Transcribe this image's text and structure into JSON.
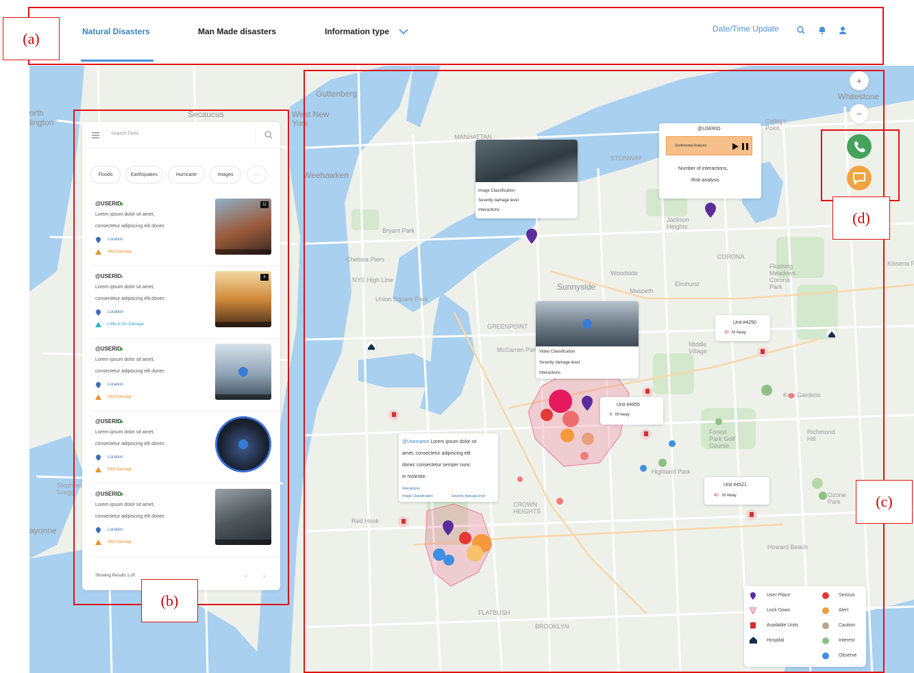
{
  "nav": {
    "tabs": [
      {
        "label": "Natural Disasters",
        "active": true
      },
      {
        "label": "Man Made disasters",
        "active": false
      },
      {
        "label": "Information type",
        "active": false
      }
    ],
    "datetime_label": "Date/Time Update",
    "icons": [
      "search-icon",
      "bell-icon",
      "user-icon",
      "chevron-down-icon"
    ]
  },
  "map": {
    "places": {
      "guttenberg": "Guttenberg",
      "secaucus": "Secaucus",
      "west_new_york": "West New York",
      "weehawken": "Weehawken",
      "manhattan": "MANHATTAN",
      "whitestone": "Whitestone",
      "college_point": "College Point",
      "jackson_heights": "Jackson Heights",
      "sunnyside": "Sunnyside",
      "woodside": "Woodside",
      "maspeth": "Maspeth",
      "elmhurst": "Elmhurst",
      "middle_village": "Middle Village",
      "kew_gardens": "Kew Gardens",
      "richmond_hill": "Richmond Hill",
      "ozone_park": "Ozone Park",
      "howard_beach": "Howard Beach",
      "brooklyn": "BROOKLYN",
      "bayonne": "ayonne",
      "steinway": "STEINWAY",
      "greenpoint": "GREENPOINT",
      "red_hook": "Red Hook",
      "crown_heights": "CROWN HEIGHTS",
      "flatbush": "FLATBUSH",
      "corona": "CORONA",
      "flushing": "Flushing Meadows Corona Park",
      "kissena": "Kissena P",
      "stephens_greg": "Stephens Gregg",
      "orth": "orth",
      "lington": "lington",
      "union_square": "Union Square Park",
      "nyc_high_line": "NYC High Line",
      "chelsea_piers": "Chelsea Piers",
      "bryant_park": "Bryant Park",
      "mccarren_park": "McCarren Park",
      "highland_park": "Highland Park",
      "forest_park": "Forest Park Golf Course"
    }
  },
  "feed": {
    "search_placeholder": "Search Feed",
    "chips": [
      "Floods",
      "Earthquakes",
      "Hurricane",
      "Images",
      "···"
    ],
    "posts": [
      {
        "user": "@USERID",
        "line1": "Lorem ipsum dolor sit amet,",
        "line2": "consectetur adipiscing elit donec",
        "location": "Location",
        "damage": "Mild Damage",
        "badge": "12",
        "damage_color": "#e6932f"
      },
      {
        "user": "@USERID",
        "line1": "Lorem ipsum dolor sit amet,",
        "line2": "consectetur adipiscing elit donec",
        "location": "Location",
        "damage": "Little to No Damage",
        "badge": "5",
        "damage_color": "#2bb3c9"
      },
      {
        "user": "@USERID",
        "line1": "Lorem ipsum dolor sit amet,",
        "line2": "consectetur adipiscing elit donec",
        "location": "Location",
        "damage": "Mild Damage",
        "badge": "",
        "damage_color": "#e6932f"
      },
      {
        "user": "@USERID",
        "line1": "Lorem ipsum dolor sit amet,",
        "line2": "consectetur adipiscing elit donec",
        "location": "Location",
        "damage": "Mild Damage",
        "badge": "",
        "damage_color": "#e6932f"
      },
      {
        "user": "@USERID",
        "line1": "Lorem ipsum dolor sit amet,",
        "line2": "consectetur adipiscing elit donec",
        "location": "Location",
        "damage": "Mild Damage",
        "badge": "",
        "damage_color": "#e6932f"
      }
    ],
    "pager": "Showing Results 1-20"
  },
  "cards": {
    "image": {
      "l1": "Image Classification",
      "l2": "Severity damage level",
      "l3": "Interactions"
    },
    "sentiment": {
      "user": "@USERID",
      "bar": "Sentimental Analysis",
      "l1": "Number of interactions,",
      "l2": "Risk analysis"
    },
    "video": {
      "l1": "Video Classification",
      "l2": "Severity damage level",
      "l3": "Interactions"
    },
    "unit1": {
      "name": "Unit #4250",
      "dist_num": "30",
      "dist_unit": "M Away"
    },
    "unit2": {
      "name": "Unit #4855",
      "dist_num": "6",
      "dist_unit": "M Away"
    },
    "unit3": {
      "name": "Unit #4521",
      "dist_num": "40",
      "dist_unit": "M Away"
    },
    "post": {
      "handle": "@Username",
      "l1": " Lorem ipsum dolor sit",
      "l2": "amet, consectetur adipiscing elit",
      "l3": "donec consectetur semper nunc",
      "l4": "in molestie.",
      "interactions": "Interactions",
      "img_class": "Image Classification",
      "severity": "Severity damage level"
    }
  },
  "zoom": {
    "plus": "+",
    "minus": "−"
  },
  "legend": {
    "user_place": "User Place",
    "lock_down": "Lock Down",
    "available_units": "Available Units",
    "hospital": "Hospital",
    "serious": "Serious",
    "alert": "Alert",
    "caution": "Caution",
    "interest": "Interest",
    "observe": "Observe",
    "colors": {
      "serious": "#e53935",
      "alert": "#f59a3c",
      "caution": "#b7a58a",
      "interest": "#8cc084",
      "observe": "#3f8fe0"
    }
  },
  "annotations": [
    "(a)",
    "(b)",
    "(c)",
    "(d)"
  ],
  "colors": {
    "accent": "#4a90d9",
    "call": "#43a35a",
    "chat": "#f0a341",
    "annotation": "#e01010"
  }
}
